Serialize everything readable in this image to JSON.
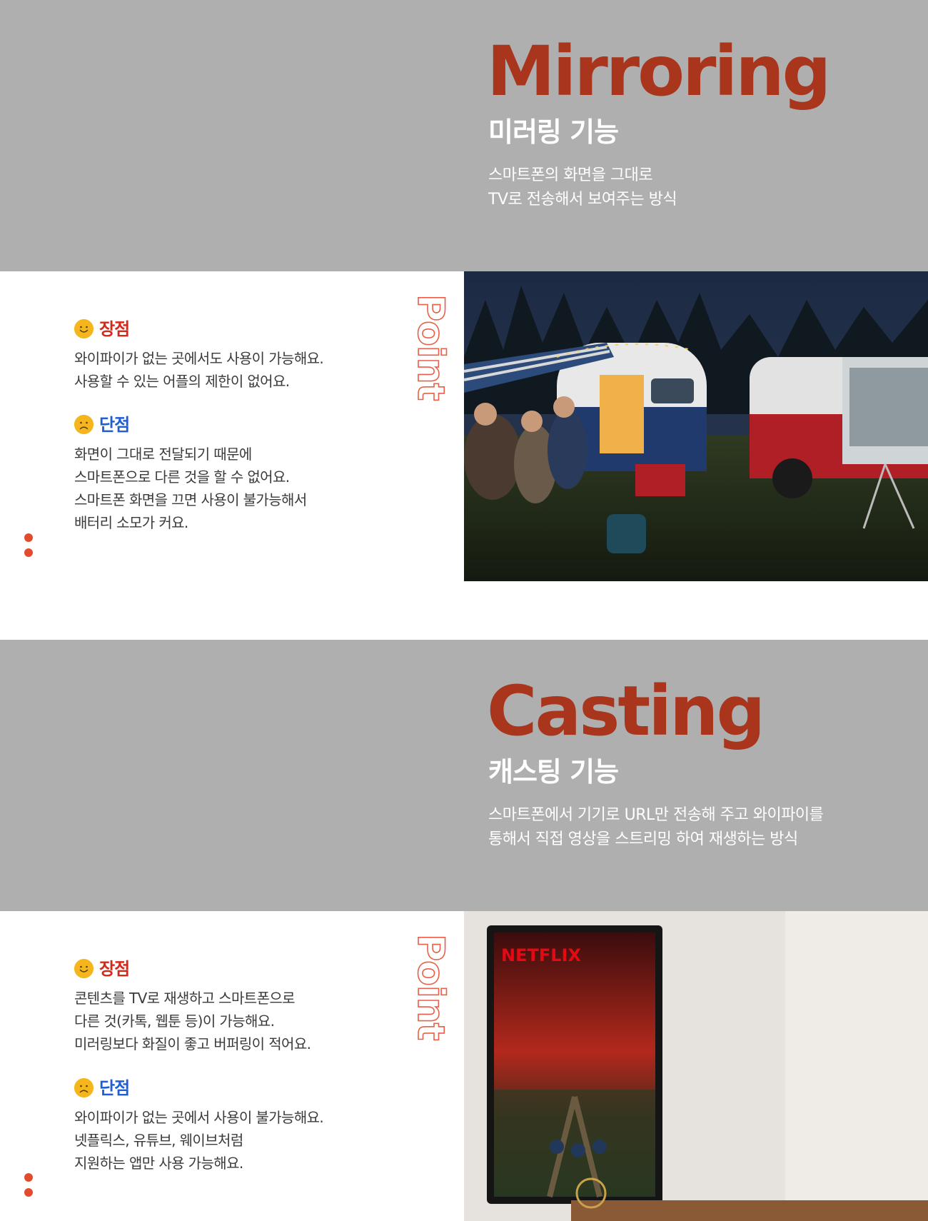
{
  "colors": {
    "band_gray": "#afafaf",
    "accent_rust": "#a8351c",
    "point_outline": "#e8604a",
    "pro_red": "#d42a1c",
    "con_blue": "#1f5fd6",
    "dot_orange": "#e24b2c"
  },
  "sections": [
    {
      "title_en": "Mirroring",
      "title_ko": "미러링 기능",
      "desc": [
        "스마트폰의 화면을 그대로",
        "TV로 전송해서 보여주는 방식"
      ],
      "point_label": "Point",
      "pros": {
        "icon": "smile-icon",
        "label": "장점",
        "lines": [
          "와이파이가 없는 곳에서도 사용이 가능해요.",
          "사용할 수 있는 어플의 제한이 없어요."
        ]
      },
      "cons": {
        "icon": "frown-icon",
        "label": "단점",
        "lines": [
          "화면이 그대로 전달되기 때문에",
          "스마트폰으로 다른 것을 할 수 없어요.",
          "스마트폰 화면을 끄면 사용이 불가능해서",
          "배터리 소모가 커요."
        ]
      },
      "photo": "camping-night-projector-photo"
    },
    {
      "title_en": "Casting",
      "title_ko": "캐스팅 기능",
      "desc": [
        "스마트폰에서 기기로 URL만 전송해 주고 와이파이를",
        "통해서 직접 영상을 스트리밍 하여 재생하는 방식"
      ],
      "point_label": "Point",
      "pros": {
        "icon": "smile-icon",
        "label": "장점",
        "lines": [
          "콘텐츠를 TV로 재생하고 스마트폰으로",
          "다른 것(카톡, 웹툰 등)이 가능해요.",
          "미러링보다 화질이 좋고 버퍼링이 적어요."
        ]
      },
      "cons": {
        "icon": "frown-icon",
        "label": "단점",
        "lines": [
          "와이파이가 없는 곳에서 사용이 불가능해요.",
          "넷플릭스, 유튜브, 웨이브처럼",
          "지원하는 앱만 사용 가능해요."
        ]
      },
      "photo": "wall-tv-netflix-photo",
      "tv_brand": "NETFLIX"
    }
  ]
}
